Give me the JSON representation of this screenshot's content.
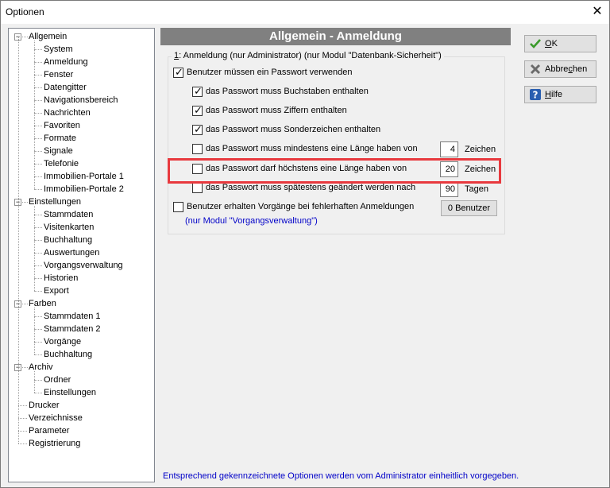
{
  "window": {
    "title": "Optionen",
    "close_glyph": "✕"
  },
  "tree": {
    "groups": [
      {
        "label": "Allgemein",
        "children": [
          "System",
          "Anmeldung",
          "Fenster",
          "Datengitter",
          "Navigationsbereich",
          "Nachrichten",
          "Favoriten",
          "Formate",
          "Signale",
          "Telefonie",
          "Immobilien-Portale 1",
          "Immobilien-Portale 2"
        ]
      },
      {
        "label": "Einstellungen",
        "children": [
          "Stammdaten",
          "Visitenkarten",
          "Buchhaltung",
          "Auswertungen",
          "Vorgangsverwaltung",
          "Historien",
          "Export"
        ]
      },
      {
        "label": "Farben",
        "children": [
          "Stammdaten 1",
          "Stammdaten 2",
          "Vorgänge",
          "Buchhaltung"
        ]
      },
      {
        "label": "Archiv",
        "children": [
          "Ordner",
          "Einstellungen"
        ]
      }
    ],
    "leaves": [
      "Drucker",
      "Verzeichnisse",
      "Parameter",
      "Registrierung"
    ],
    "expander": "−"
  },
  "header": {
    "title": "Allgemein - Anmeldung"
  },
  "group": {
    "legend_num": "1",
    "legend_rest": ": Anmeldung  (nur Administrator)  (nur Modul \"Datenbank-Sicherheit\")"
  },
  "options": {
    "use_password": {
      "label": "Benutzer müssen ein Passwort verwenden",
      "checked": true
    },
    "letters": {
      "label": "das Passwort muss Buchstaben enthalten",
      "checked": true
    },
    "digits": {
      "label": "das Passwort muss Ziffern enthalten",
      "checked": true
    },
    "special": {
      "label": "das Passwort muss Sonderzeichen enthalten",
      "checked": true
    },
    "min_length": {
      "label": "das Passwort muss mindestens eine Länge haben von",
      "checked": false,
      "value": "4",
      "unit": "Zeichen"
    },
    "max_length": {
      "label": "das Passwort darf höchstens eine Länge haben von",
      "checked": false,
      "value": "20",
      "unit": "Zeichen"
    },
    "change_after": {
      "label": "das Passwort muss spätestens geändert werden nach",
      "checked": false,
      "value": "90",
      "unit": "Tagen"
    },
    "failed_logins": {
      "label": "Benutzer erhalten Vorgänge bei fehlerhaften Anmeldungen",
      "checked": false,
      "note": "(nur Modul \"Vorgangsverwaltung\")"
    }
  },
  "users_button": {
    "label": "0 Benutzer"
  },
  "buttons": {
    "ok": {
      "label": "OK",
      "accel": "O",
      "rest": "K"
    },
    "cancel": {
      "label": "Abbrechen",
      "pre": "Abbre",
      "accel": "c",
      "rest": "hen"
    },
    "help": {
      "label": "Hilfe",
      "accel": "H",
      "rest": "ilfe"
    }
  },
  "footer": {
    "text": "Entsprechend gekennzeichnete Optionen werden vom Administrator einheitlich vorgegeben."
  },
  "colors": {
    "header_bg": "#808080",
    "highlight": "#e8393e",
    "note_blue": "#0000c8"
  }
}
